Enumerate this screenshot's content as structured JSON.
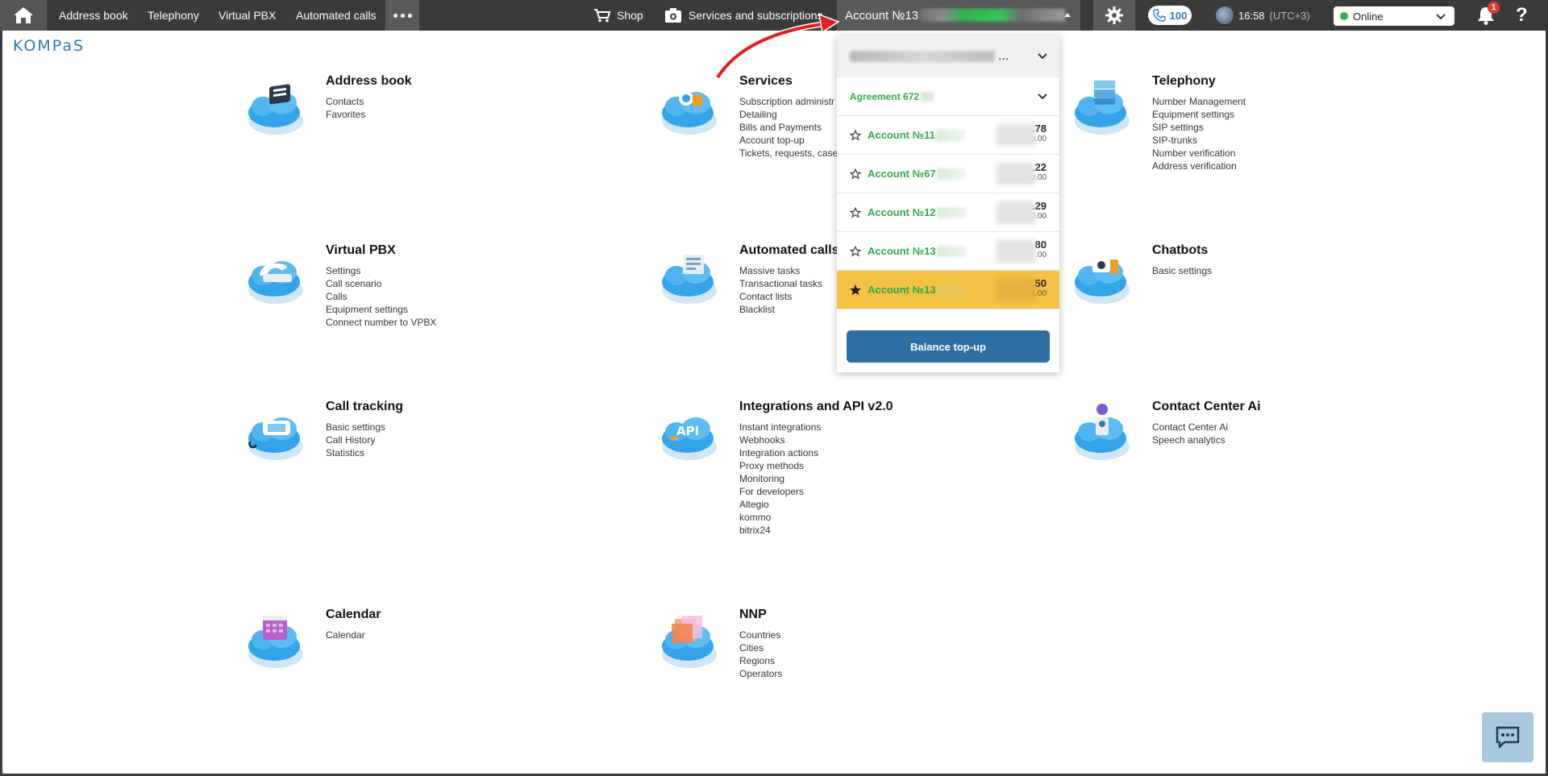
{
  "topbar": {
    "nav": [
      "Address book",
      "Telephony",
      "Virtual PBX",
      "Automated calls"
    ],
    "shop": "Shop",
    "services": "Services and subscriptions",
    "account_label": "Account №13",
    "calls_count": "100",
    "time": "16:58",
    "timezone": "(UTC+3)",
    "status": "Online",
    "notifications": "1",
    "help": "?"
  },
  "logo": "KOMPaS",
  "modules": [
    {
      "title": "Address book",
      "icon": "address-book-cloud-icon",
      "links": [
        "Contacts",
        "Favorites"
      ]
    },
    {
      "title": "Services",
      "icon": "services-cloud-icon",
      "links": [
        "Subscription administr",
        "Detailing",
        "Bills and Payments",
        "Account top-up",
        "Tickets, requests, cases"
      ]
    },
    {
      "title": "Telephony",
      "icon": "telephony-cloud-icon",
      "links": [
        "Number Management",
        "Equipment settings",
        "SIP settings",
        "SIP-trunks",
        "Number verification",
        "Address verification"
      ]
    },
    {
      "title": "Virtual PBX",
      "icon": "virtual-pbx-cloud-icon",
      "links": [
        "Settings",
        "Call scenario",
        "Calls",
        "Equipment settings",
        "Connect number to VPBX"
      ]
    },
    {
      "title": "Automated calls",
      "icon": "automated-calls-cloud-icon",
      "links": [
        "Massive tasks",
        "Transactional tasks",
        "Contact lists",
        "Blacklist"
      ]
    },
    {
      "title": "Chatbots",
      "icon": "chatbots-cloud-icon",
      "links": [
        "Basic settings"
      ]
    },
    {
      "title": "Call tracking",
      "icon": "call-tracking-cloud-icon",
      "links": [
        "Basic settings",
        "Call History",
        "Statistics"
      ]
    },
    {
      "title": "Integrations and API v2.0",
      "icon": "api-cloud-icon",
      "links": [
        "Instant integrations",
        "Webhooks",
        "Integration actions",
        "Proxy methods",
        "Monitoring",
        "For developers",
        "Altegio",
        "kommo",
        "bitrix24"
      ]
    },
    {
      "title": "Contact Center Ai",
      "icon": "contact-center-ai-cloud-icon",
      "links": [
        "Contact Center Ai",
        "Speech analytics"
      ]
    },
    {
      "title": "Calendar",
      "icon": "calendar-cloud-icon",
      "links": [
        "Calendar"
      ]
    },
    {
      "title": "NNP",
      "icon": "nnp-cloud-icon",
      "links": [
        "Countries",
        "Cities",
        "Regions",
        "Operators"
      ]
    }
  ],
  "dropdown": {
    "ellipsis": "...",
    "agreement": "Agreement 672",
    "accounts": [
      {
        "name": "Account №11",
        "balance": ".78",
        "sub": "0.00",
        "active": false
      },
      {
        "name": "Account №67",
        "balance": ".22",
        "sub": "0.00",
        "active": false
      },
      {
        "name": "Account №12",
        "balance": ".29",
        "sub": "0.00",
        "active": false
      },
      {
        "name": "Account №13",
        "balance": "80",
        "sub": ".00",
        "active": false
      },
      {
        "name": "Account №13",
        "balance": ".50",
        "sub": "1.00",
        "active": true
      }
    ],
    "button": "Balance top-up"
  },
  "colors": {
    "topbar": "#3a3a3a",
    "accent_green": "#2fa74a",
    "active_account": "#f3c244",
    "button_blue": "#2e6fa3",
    "logo_blue": "#2b7ab3"
  }
}
